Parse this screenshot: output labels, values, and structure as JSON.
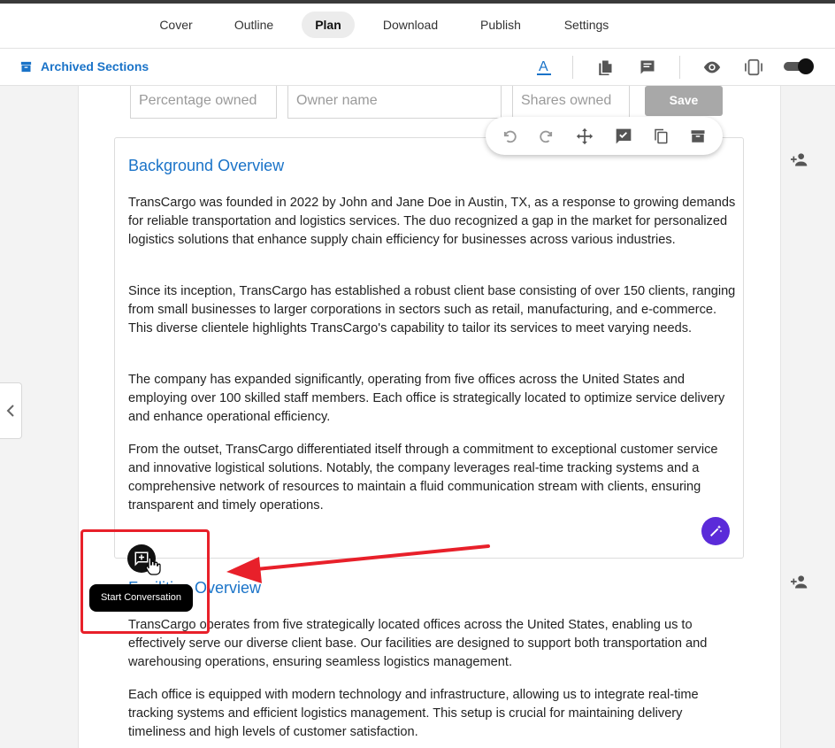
{
  "tabs": [
    {
      "label": "Cover",
      "active": false
    },
    {
      "label": "Outline",
      "active": false
    },
    {
      "label": "Plan",
      "active": true
    },
    {
      "label": "Download",
      "active": false
    },
    {
      "label": "Publish",
      "active": false
    },
    {
      "label": "Settings",
      "active": false
    }
  ],
  "toolbar": {
    "archived_label": "Archived Sections",
    "icons": [
      "text-color-icon",
      "document-icon",
      "comment-icon",
      "preview-eye-icon",
      "device-frame-icon",
      "toggle-switch"
    ]
  },
  "ownership_form": {
    "percentage_placeholder": "Percentage owned",
    "owner_placeholder": "Owner name",
    "shares_placeholder": "Shares owned",
    "save_label": "Save"
  },
  "floating_toolbar": {
    "icons": [
      "undo-icon",
      "redo-icon",
      "move-icon",
      "approve-comment-icon",
      "copy-icon",
      "archive-icon"
    ]
  },
  "sections": [
    {
      "title": "Background Overview",
      "paragraphs": [
        "TransCargo was founded in 2022 by John and Jane Doe in Austin, TX, as a response to growing demands for reliable transportation and logistics services. The duo recognized a gap in the market for personalized logistics solutions that enhance supply chain efficiency for businesses across various industries.",
        "Since its inception, TransCargo has established a robust client base consisting of over 150 clients, ranging from small businesses to larger corporations in sectors such as retail, manufacturing, and e-commerce. This diverse clientele highlights TransCargo's capability to tailor its services to meet varying needs.",
        "The company has expanded significantly, operating from five offices across the United States and employing over 100 skilled staff members. Each office is strategically located to optimize service delivery and enhance operational efficiency.",
        "From the outset, TransCargo differentiated itself through a commitment to exceptional customer service and innovative logistical solutions. Notably, the company leverages real-time tracking systems and a comprehensive network of resources to maintain a fluid communication stream with clients, ensuring transparent and timely operations."
      ]
    },
    {
      "title": "Facilities Overview",
      "paragraphs": [
        "TransCargo operates from five strategically located offices across the United States, enabling us to effectively serve our diverse client base. Our facilities are designed to support both transportation and warehousing operations, ensuring seamless logistics management.",
        "Each office is equipped with modern technology and infrastructure, allowing us to integrate real-time tracking systems and efficient logistics management. This setup is crucial for maintaining delivery timeliness and high levels of customer satisfaction."
      ]
    }
  ],
  "tooltip": {
    "text": "Start Conversation"
  },
  "colors": {
    "accent": "#1a73c8",
    "magic_button": "#5b2bd9",
    "annotation": "#e8202a"
  }
}
